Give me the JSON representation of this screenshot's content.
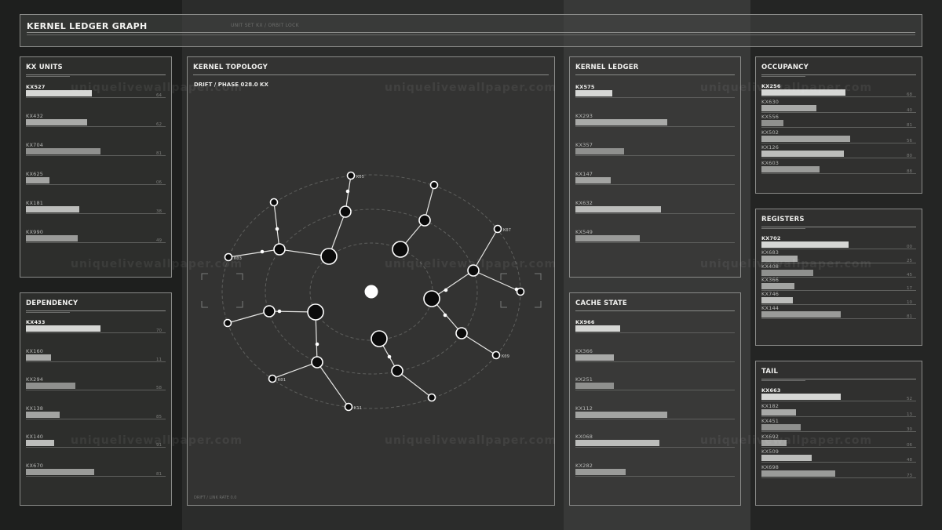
{
  "header": {
    "title": "KERNEL LEDGER GRAPH",
    "subtitle": "UNIT SET KX / ORBIT LOCK"
  },
  "watermark": "uniquelivewallpaper.com",
  "panels": {
    "kx_units": {
      "title": "KX UNITS",
      "rows": [
        {
          "label": "KX527",
          "value": 0.56,
          "num": "64",
          "strong": true
        },
        {
          "label": "KX432",
          "value": 0.52,
          "num": "62",
          "strong": false
        },
        {
          "label": "KX704",
          "value": 0.63,
          "num": "81",
          "strong": false
        },
        {
          "label": "KX625",
          "value": 0.2,
          "num": "06",
          "strong": false
        },
        {
          "label": "KX181",
          "value": 0.45,
          "num": "38",
          "strong": false
        },
        {
          "label": "KX990",
          "value": 0.44,
          "num": "49",
          "strong": false
        }
      ]
    },
    "dependency": {
      "title": "DEPENDENCY",
      "rows": [
        {
          "label": "KX433",
          "value": 0.68,
          "num": "70",
          "strong": true
        },
        {
          "label": "KX160",
          "value": 0.23,
          "num": "11",
          "strong": false
        },
        {
          "label": "KX294",
          "value": 0.45,
          "num": "58",
          "strong": false
        },
        {
          "label": "KX138",
          "value": 0.31,
          "num": "85",
          "strong": false
        },
        {
          "label": "KX140",
          "value": 0.26,
          "num": "91",
          "strong": false
        },
        {
          "label": "KX670",
          "value": 0.62,
          "num": "81",
          "strong": false
        }
      ]
    },
    "topology": {
      "title": "KERNEL TOPOLOGY",
      "subtitle": "DRIFT / PHASE 028.0 KX",
      "footer": "DRIFT / LINK RATE 0.0"
    },
    "kernel_ledger": {
      "title": "KERNEL LEDGER",
      "rows": [
        {
          "label": "KX575",
          "value": 0.23,
          "num": "",
          "strong": true
        },
        {
          "label": "KX293",
          "value": 0.57,
          "num": "",
          "strong": false
        },
        {
          "label": "KX357",
          "value": 0.3,
          "num": "",
          "strong": false
        },
        {
          "label": "KX147",
          "value": 0.22,
          "num": "",
          "strong": false
        },
        {
          "label": "KX632",
          "value": 0.53,
          "num": "",
          "strong": false
        },
        {
          "label": "KX549",
          "value": 0.4,
          "num": "",
          "strong": false
        }
      ]
    },
    "cache_state": {
      "title": "CACHE STATE",
      "rows": [
        {
          "label": "KX966",
          "value": 0.28,
          "num": "",
          "strong": true
        },
        {
          "label": "KX366",
          "value": 0.24,
          "num": "",
          "strong": false
        },
        {
          "label": "KX251",
          "value": 0.24,
          "num": "",
          "strong": false
        },
        {
          "label": "KX112",
          "value": 0.57,
          "num": "",
          "strong": false
        },
        {
          "label": "KX068",
          "value": 0.52,
          "num": "",
          "strong": false
        },
        {
          "label": "KX282",
          "value": 0.31,
          "num": "",
          "strong": false
        }
      ]
    },
    "occupancy": {
      "title": "OCCUPANCY",
      "rows": [
        {
          "label": "KX256",
          "value": 0.54,
          "num": "68",
          "strong": true
        },
        {
          "label": "KX630",
          "value": 0.35,
          "num": "40",
          "strong": false
        },
        {
          "label": "KX556",
          "value": 0.14,
          "num": "81",
          "strong": false
        },
        {
          "label": "KX502",
          "value": 0.57,
          "num": "56",
          "strong": false
        },
        {
          "label": "KX126",
          "value": 0.53,
          "num": "80",
          "strong": false
        },
        {
          "label": "KX603",
          "value": 0.37,
          "num": "88",
          "strong": false
        }
      ]
    },
    "registers": {
      "title": "REGISTERS",
      "rows": [
        {
          "label": "KX702",
          "value": 0.56,
          "num": "00",
          "strong": true
        },
        {
          "label": "KX683",
          "value": 0.23,
          "num": "25",
          "strong": false
        },
        {
          "label": "KX408",
          "value": 0.33,
          "num": "45",
          "strong": false
        },
        {
          "label": "KX366",
          "value": 0.21,
          "num": "17",
          "strong": false
        },
        {
          "label": "KX746",
          "value": 0.2,
          "num": "10",
          "strong": false
        },
        {
          "label": "KX144",
          "value": 0.51,
          "num": "81",
          "strong": false
        }
      ]
    },
    "tail": {
      "title": "TAIL",
      "rows": [
        {
          "label": "KX663",
          "value": 0.51,
          "num": "52",
          "strong": true
        },
        {
          "label": "KX182",
          "value": 0.22,
          "num": "13",
          "strong": false
        },
        {
          "label": "KX451",
          "value": 0.25,
          "num": "30",
          "strong": false
        },
        {
          "label": "KX692",
          "value": 0.16,
          "num": "06",
          "strong": false
        },
        {
          "label": "KX509",
          "value": 0.32,
          "num": "48",
          "strong": false
        },
        {
          "label": "KX698",
          "value": 0.47,
          "num": "73",
          "strong": false
        }
      ]
    }
  },
  "graph_labels": {
    "k05": "K05",
    "k03": "K03",
    "k07": "K07",
    "k01": "K01",
    "k09": "K09",
    "k11": "K11"
  }
}
